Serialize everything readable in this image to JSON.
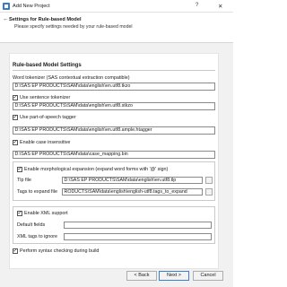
{
  "window": {
    "title": "Add New Project",
    "help_label": "?",
    "close_label": "✕"
  },
  "header": {
    "back_label": "←",
    "title": "Settings for Rule-based Model",
    "subtitle": "Please specify settings needed by your rule-based model"
  },
  "section": {
    "heading": "Rule-based Model Settings"
  },
  "fields": {
    "word_tokenizer_label": "Word tokenizer (SAS contextual extraction compatible)",
    "word_tokenizer_value": "D:\\SAS EP PRODUCTS\\SAM\\data\\english\\en.utf8.tkzo",
    "sentence_tokenizer_label": "Use sentence tokenizer",
    "sentence_tokenizer_checked": true,
    "sentence_tokenizer_value": "D:\\SAS EP PRODUCTS\\SAM\\data\\english\\en.utf8.stkzo",
    "pos_tagger_label": "Use part-of-speech tagger",
    "pos_tagger_checked": true,
    "pos_tagger_value": "D:\\SAS EP PRODUCTS\\SAM\\data\\english\\en.utf8.ample.htagger",
    "case_insensitive_label": "Enable case insensitive",
    "case_insensitive_checked": true,
    "case_insensitive_value": "D:\\SAS EP PRODUCTS\\SAM\\data\\case_mapping.bin"
  },
  "morph_group": {
    "enable_label": "Enable morphological expansion (expand word forms with '@' sign)",
    "enable_checked": true,
    "tlp_label": "Tlp file",
    "tlp_value": "D:\\SAS EP PRODUCTS\\SAM\\data\\english\\en.utf8.tlp",
    "tags_label": "Tags to expand file",
    "tags_value": "RODUCTS\\SAM\\data\\english\\english-utf8.tags_to_expand"
  },
  "xml_group": {
    "enable_label": "Enable XML support",
    "enable_checked": true,
    "default_fields_label": "Default fields",
    "default_fields_value": "",
    "ignore_tags_label": "XML tags to ignore",
    "ignore_tags_value": ""
  },
  "syntax_check": {
    "label": "Perform syntax checking during build",
    "checked": true
  },
  "buttons": {
    "back_label": "< Back",
    "next_label": "Next >",
    "cancel_label": "Cancel"
  },
  "colors": {
    "accent": "#3a78c8",
    "panel_background": "#f1f1f1"
  }
}
